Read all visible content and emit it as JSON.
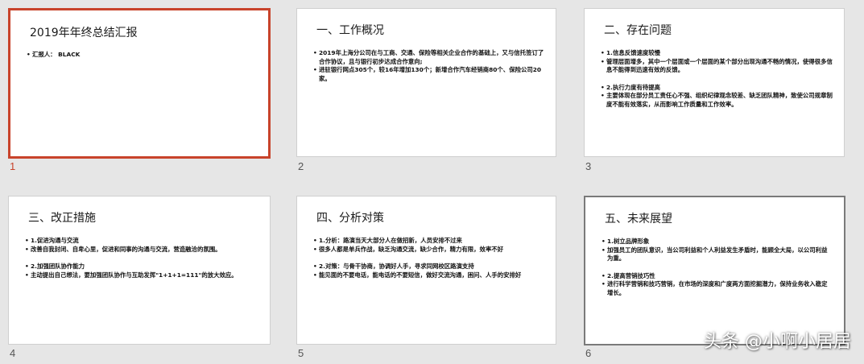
{
  "slides": [
    {
      "number": "1",
      "title": "2019年年终总结汇报",
      "lines": [
        "汇报人： BLACK"
      ]
    },
    {
      "number": "2",
      "title": "一、工作概况",
      "lines": [
        "2019年上海分公司在与工商、交通、保险等相关企业合作的基础上，又与信托签订了合作协议，且与银行初步达成合作意向;",
        "进驻银行网点305个，较16年增加130个；新增合作汽车经销商80个、保险公司20家。"
      ]
    },
    {
      "number": "3",
      "title": "二、存在问题",
      "lines": [
        "1.信息反馈速度较慢",
        "管理层面增多，其中一个层面或一个层面的某个部分出现沟通不畅的情况，使得很多信息不能得到迅速有效的反馈。",
        "2.执行力度有待提高",
        "主要体现在部分员工责任心不强、组织纪律观念较差、缺乏团队精神，致使公司规章制度不能有效落实，从而影响工作质量和工作效率。"
      ]
    },
    {
      "number": "4",
      "title": "三、改正措施",
      "lines": [
        "1.促进沟通与交流",
        "改善自我封闭、自卑心里，促进和同事的沟通与交流，营造融洽的氛围。",
        "2.加强团队协作能力",
        "主动提出自己想法，要加强团队协作与互助发挥\"1+1+1=111\"的放大效应。"
      ]
    },
    {
      "number": "5",
      "title": "四、分析对策",
      "lines": [
        "1.分析：路演当天大部分人在做招新，人员安排不过来",
        "很多人都是单兵作战，缺乏沟通交流，缺少合作，精力有限，效率不好",
        "2.对策：与骨干协商，协调好人手，寻求同网校区路演支持",
        "能见面的不要电话，能电话的不要短信，做好交流沟通，困问、人手的安排好"
      ]
    },
    {
      "number": "6",
      "title": "五、未来展望",
      "lines": [
        "1.树立品牌形象",
        "加强员工的团队意识，当公司利益和个人利益发生矛盾时，能顾全大局，以公司利益为重。",
        "2.提高营销技巧性",
        "进行科学营销和技巧营销，在市场的深度和广度两方面挖掘潜力，保持业务收入稳定增长。"
      ]
    }
  ],
  "watermark": "头条 @小啊小居居",
  "colors": {
    "selected_border": "#c8432b",
    "background": "#e6e6e6"
  }
}
